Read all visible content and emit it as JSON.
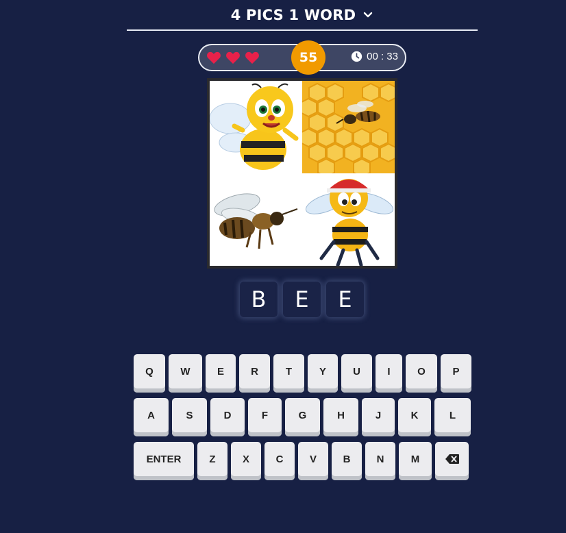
{
  "header": {
    "title": "4 PICS 1 WORD",
    "menu_icon": "chevron-down-icon"
  },
  "status": {
    "lives": 3,
    "lives_icon": "heart-icon",
    "heart_color": "#e8214a",
    "level": "55",
    "level_color": "#f19a00",
    "timer": "00 : 33",
    "timer_icon": "clock-icon"
  },
  "puzzle": {
    "pictures": [
      "cartoon-bee-icon",
      "honeybee-on-honeycomb-icon",
      "flying-bee-icon",
      "bee-with-cap-icon"
    ],
    "answer": [
      "B",
      "E",
      "E"
    ]
  },
  "keyboard": {
    "rows": [
      [
        "Q",
        "W",
        "E",
        "R",
        "T",
        "Y",
        "U",
        "I",
        "O",
        "P"
      ],
      [
        "A",
        "S",
        "D",
        "F",
        "G",
        "H",
        "J",
        "K",
        "L"
      ],
      [
        "ENTER",
        "Z",
        "X",
        "C",
        "V",
        "B",
        "N",
        "M"
      ]
    ],
    "backspace_icon": "backspace-icon"
  }
}
